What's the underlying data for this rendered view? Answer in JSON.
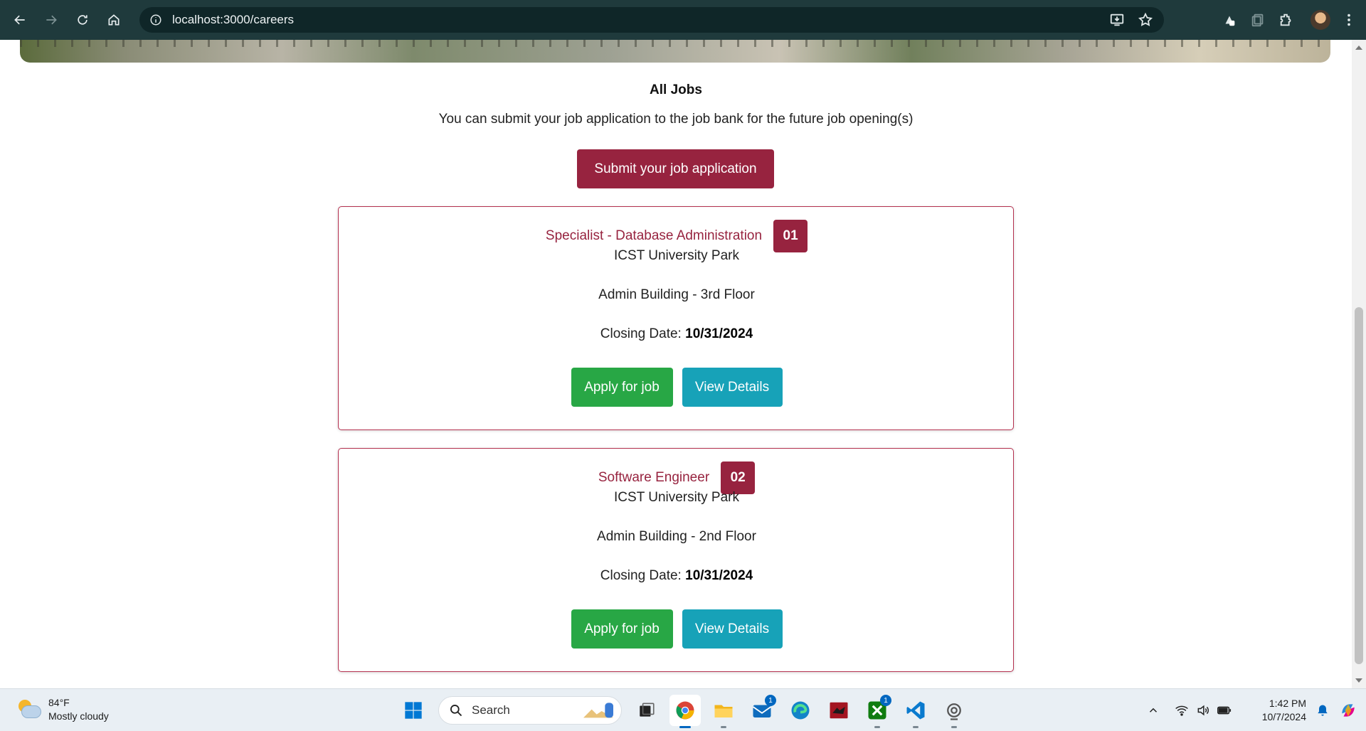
{
  "browser": {
    "url": "localhost:3000/careers"
  },
  "page": {
    "heading": "All Jobs",
    "subtitle": "You can submit your job application to the job bank for the future job opening(s)",
    "submit_label": "Submit your job application"
  },
  "jobs": [
    {
      "title": "Specialist - Database Administration",
      "badge": "01",
      "location": "ICST University Park",
      "building": "Admin Building - 3rd Floor",
      "closing_label": "Closing Date:",
      "closing_date": "10/31/2024",
      "apply_label": "Apply for job",
      "details_label": "View Details"
    },
    {
      "title": "Software Engineer",
      "badge": "02",
      "location": "ICST University Park",
      "building": "Admin Building - 2nd Floor",
      "closing_label": "Closing Date:",
      "closing_date": "10/31/2024",
      "apply_label": "Apply for job",
      "details_label": "View Details"
    }
  ],
  "colors": {
    "brand": "#97233f",
    "success": "#28a745",
    "info": "#17a2b8",
    "chrome": "#1f3a3c"
  },
  "taskbar": {
    "weather_temp": "84°F",
    "weather_desc": "Mostly cloudy",
    "search_label": "Search",
    "time": "1:42 PM",
    "date": "10/7/2024",
    "mail_badge": "1",
    "xbox_badge": "1"
  }
}
